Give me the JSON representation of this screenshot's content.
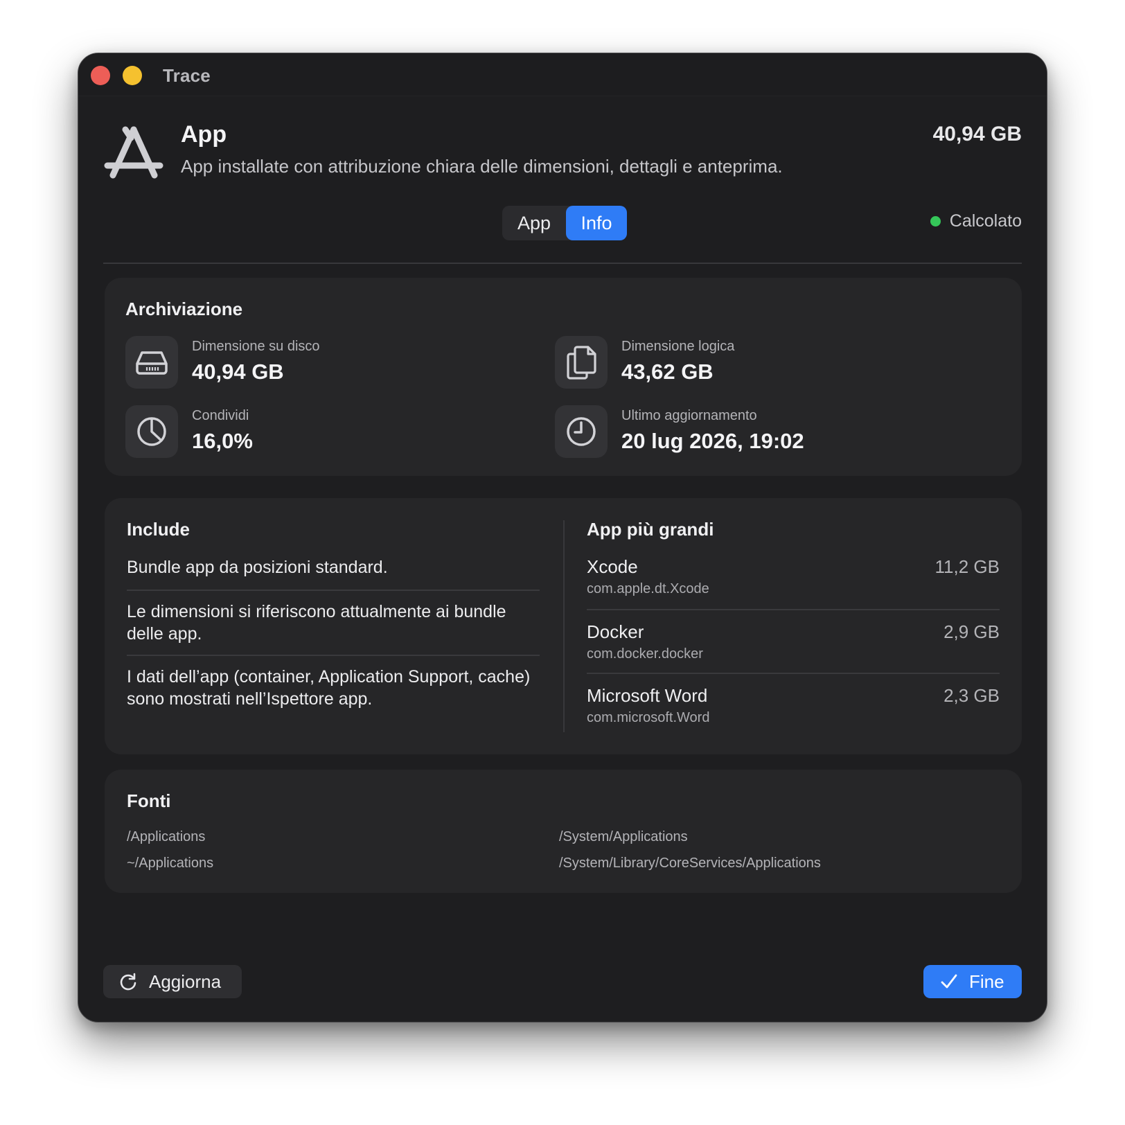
{
  "window": {
    "title": "Trace"
  },
  "header": {
    "title": "App",
    "subtitle": "App installate con attribuzione chiara delle dimensioni, dettagli e anteprima.",
    "total_size": "40,94 GB",
    "icon": "app-store-icon"
  },
  "tabs": [
    {
      "label": "App",
      "selected": false
    },
    {
      "label": "Info",
      "selected": true
    }
  ],
  "status": {
    "label": "Calcolato",
    "color": "#35c759"
  },
  "storage": {
    "title": "Archiviazione",
    "disk_size": {
      "label": "Dimensione su disco",
      "value": "40,94 GB",
      "icon": "drive-icon"
    },
    "logical_size": {
      "label": "Dimensione logica",
      "value": "43,62 GB",
      "icon": "documents-icon"
    },
    "share": {
      "label": "Condividi",
      "value": "16,0%",
      "icon": "pie-chart-icon"
    },
    "last_update": {
      "label": "Ultimo aggiornamento",
      "value": "20 lug 2026, 19:02",
      "icon": "clock-icon"
    }
  },
  "include": {
    "title": "Include",
    "items": [
      "Bundle app da posizioni standard.",
      "Le dimensioni si riferiscono attualmente ai bundle delle app.",
      "I dati dell’app (container, Application Support, cache) sono mostrati nell’Ispettore app."
    ]
  },
  "largest_apps": {
    "title": "App più grandi",
    "items": [
      {
        "name": "Xcode",
        "bundle_id": "com.apple.dt.Xcode",
        "size": "11,2 GB"
      },
      {
        "name": "Docker",
        "bundle_id": "com.docker.docker",
        "size": "2,9 GB"
      },
      {
        "name": "Microsoft Word",
        "bundle_id": "com.microsoft.Word",
        "size": "2,3 GB"
      }
    ]
  },
  "sources": {
    "title": "Fonti",
    "paths": [
      "/Applications",
      "/System/Applications",
      "~/Applications",
      "/System/Library/CoreServices/Applications"
    ]
  },
  "footer": {
    "refresh_label": "Aggiorna",
    "done_label": "Fine"
  },
  "colors": {
    "accent": "#2f7cf6",
    "close": "#ed5e57",
    "minimize": "#f5c12f"
  }
}
